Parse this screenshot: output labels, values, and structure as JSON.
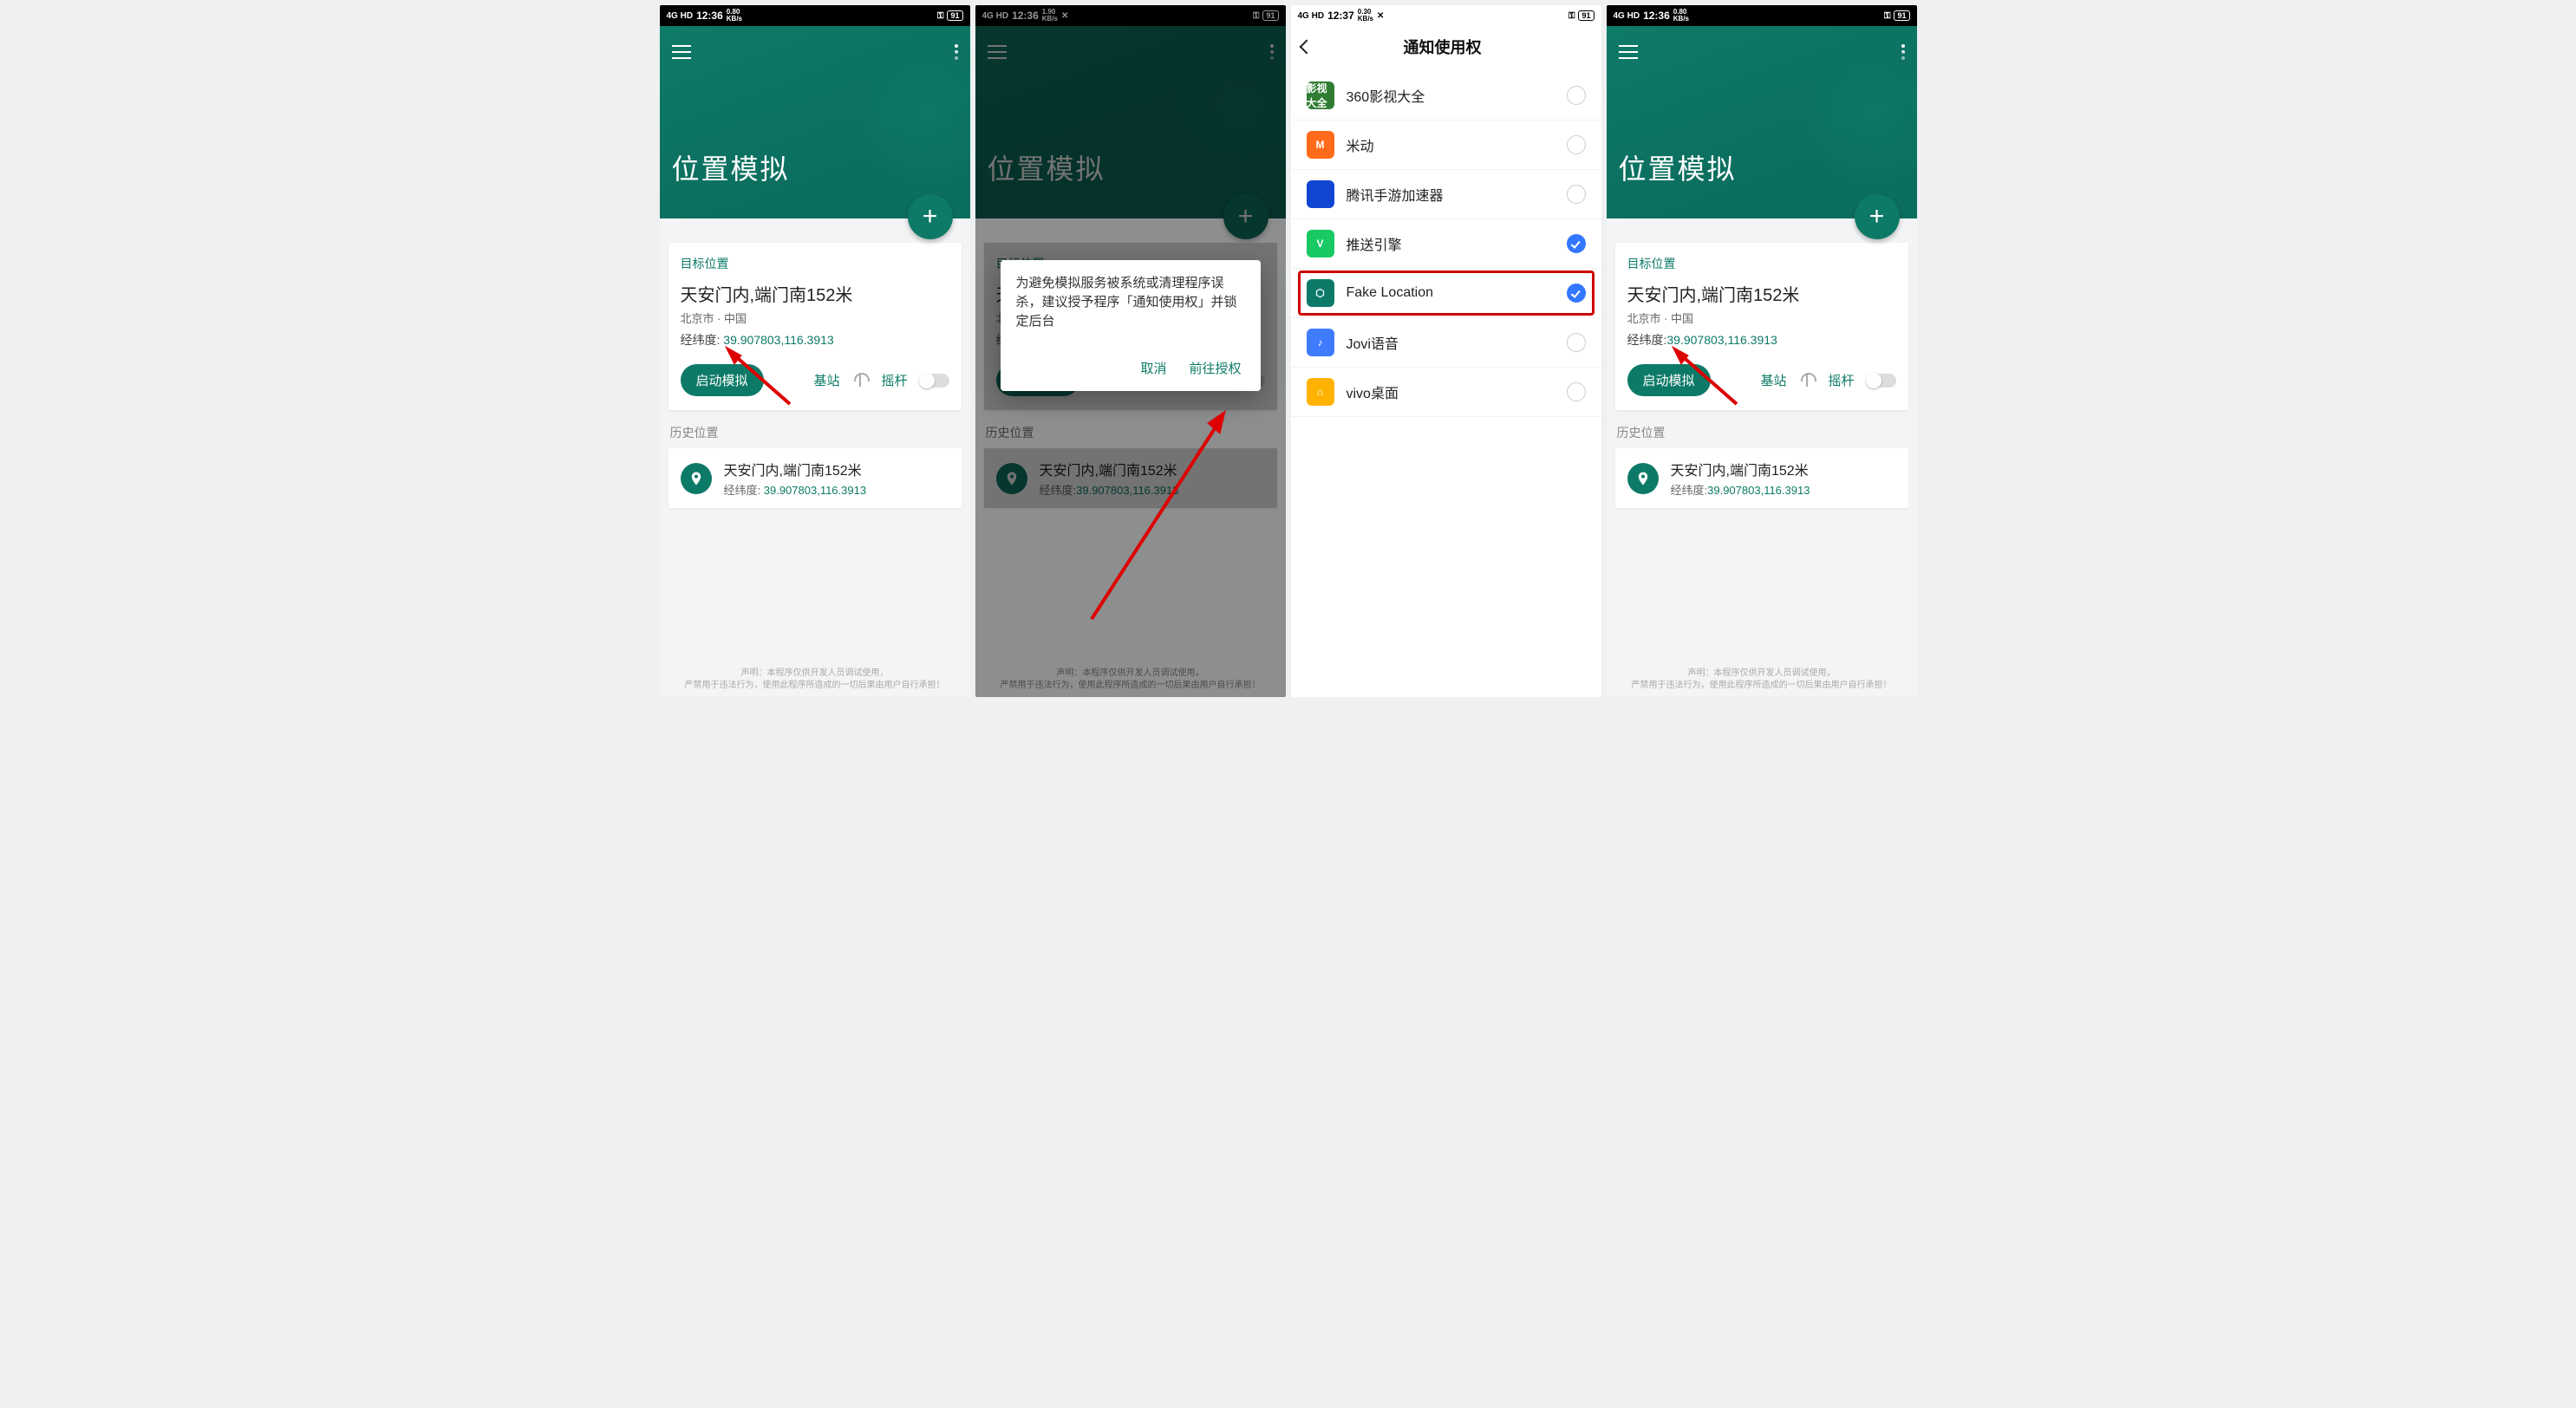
{
  "status": {
    "sig": "4G HD",
    "time1": "12:36",
    "time2": "12:36",
    "time3": "12:37",
    "time4": "12:36",
    "kbps1": "0.80\nKB/s",
    "kbps2": "1.90\nKB/s",
    "kbps3": "0.30\nKB/s",
    "kbps4": "0.80\nKB/s",
    "tools": "✕",
    "battery": "91"
  },
  "app": {
    "title": "位置模拟",
    "target_label": "目标位置",
    "loc_title": "天安门内,端门南152米",
    "loc_sub": "北京市 · 中国",
    "coord_key": "经纬度:",
    "coord_val": "39.907803,116.3913",
    "start_btn": "启动模拟",
    "base_label": "基站",
    "joy_label": "摇杆",
    "history_label": "历史位置",
    "footer1": "声明：本程序仅供开发人员调试使用，",
    "footer2": "严禁用于违法行为，使用此程序所造成的一切后果由用户自行承担！"
  },
  "dialog": {
    "text": "为避免模拟服务被系统或清理程序误杀，建议授予程序「通知使用权」并锁定后台",
    "cancel": "取消",
    "go": "前往授权"
  },
  "settings": {
    "title": "通知使用权",
    "items": [
      {
        "name": "360影视大全",
        "iconText": "影视大全",
        "bg": "#2f7d32",
        "on": false
      },
      {
        "name": "米动",
        "iconText": "M",
        "bg": "#ff6b1a",
        "on": false
      },
      {
        "name": "腾讯手游加速器",
        "iconText": "",
        "bg": "#1146d3",
        "on": false
      },
      {
        "name": "推送引擎",
        "iconText": "V",
        "bg": "#18c964",
        "on": true
      },
      {
        "name": "Fake Location",
        "iconText": "⬡",
        "bg": "#0d7a67",
        "on": true,
        "highlight": true
      },
      {
        "name": "Jovi语音",
        "iconText": "♪",
        "bg": "#3f7bff",
        "on": false
      },
      {
        "name": "vivo桌面",
        "iconText": "⌂",
        "bg": "#ffb300",
        "on": false
      }
    ]
  }
}
